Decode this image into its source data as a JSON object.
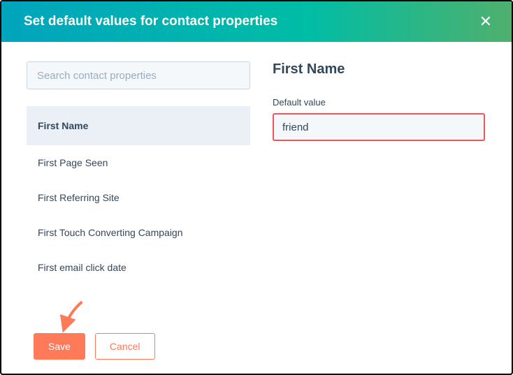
{
  "header": {
    "title": "Set default values for contact properties",
    "close_label": "✕"
  },
  "search": {
    "placeholder": "Search contact properties",
    "value": ""
  },
  "properties": {
    "items": [
      {
        "label": "First Name",
        "selected": true
      },
      {
        "label": "First Page Seen",
        "selected": false
      },
      {
        "label": "First Referring Site",
        "selected": false
      },
      {
        "label": "First Touch Converting Campaign",
        "selected": false
      },
      {
        "label": "First email click date",
        "selected": false
      }
    ]
  },
  "detail": {
    "title": "First Name",
    "field_label": "Default value",
    "value": "friend"
  },
  "footer": {
    "save_label": "Save",
    "cancel_label": "Cancel"
  },
  "colors": {
    "accent": "#ff7a59",
    "teal": "#00a4bd",
    "text": "#33475b"
  }
}
